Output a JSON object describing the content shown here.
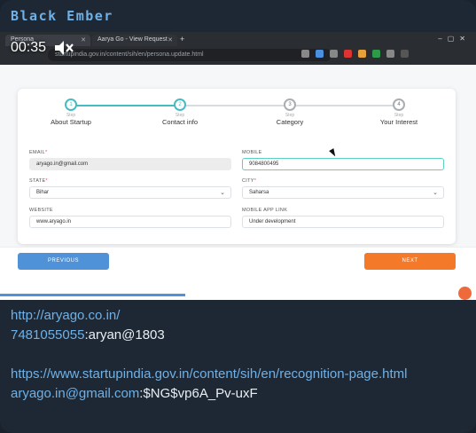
{
  "sender": "Black Ember",
  "video": {
    "timer": "00:35",
    "browser": {
      "tabs": [
        "Persona",
        "Aarya Go - View Request"
      ],
      "url": "startupindia.gov.in/content/sih/en/persona.update.html"
    },
    "steps": [
      {
        "num": "1",
        "sub": "Step",
        "label": "About Startup"
      },
      {
        "num": "2",
        "sub": "Step",
        "label": "Contact info"
      },
      {
        "num": "3",
        "sub": "Step",
        "label": "Category"
      },
      {
        "num": "4",
        "sub": "Step",
        "label": "Your Interest"
      }
    ],
    "form": {
      "email": {
        "label": "EMAIL",
        "value": "aryago.in@gmail.com"
      },
      "mobile": {
        "label": "MOBILE",
        "value": "9084800495"
      },
      "state": {
        "label": "STATE",
        "value": "Bihar"
      },
      "city": {
        "label": "CITY",
        "value": "Saharsa"
      },
      "website": {
        "label": "WEBSITE",
        "value": "www.aryago.in"
      },
      "app_link": {
        "label": "MOBILE APP LINK",
        "value": "Under development"
      }
    },
    "buttons": {
      "previous": "PREVIOUS",
      "next": "NEXT"
    },
    "accessibility_icon": "accessibility-icon"
  },
  "message": {
    "line1": "http://aryago.co.in/",
    "line2_link": "7481055055",
    "line2_text": ":aryan@1803",
    "line3": "https://www.startupindia.gov.in/content/sih/en/recognition-page.html",
    "line4_link": "aryago.in@gmail.com",
    "line4_text": ":$NG$vp6A_Pv-uxF"
  },
  "colors": {
    "accent": "#6fb1e6",
    "teal": "#46bcc0",
    "next": "#f47a2a",
    "prev": "#4f92d8"
  }
}
